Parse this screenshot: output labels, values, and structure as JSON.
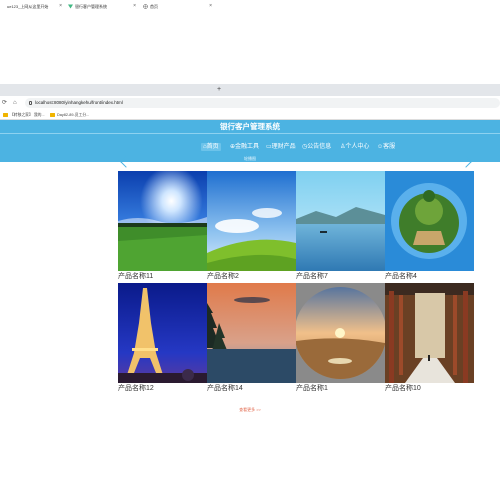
{
  "browser": {
    "tabs": [
      {
        "title": "ue123_上网从这里开始"
      },
      {
        "title": "银行客户管理系统"
      },
      {
        "title": "首页"
      }
    ],
    "new_tab": "+",
    "url": "localhost:8080/yinhangkehu/front/index.html",
    "bookmarks": [
      {
        "label": "【转移之家】 我的..."
      },
      {
        "label": "Day82-89-员工分..."
      }
    ]
  },
  "site": {
    "title": "银行客户管理系统",
    "menu": [
      {
        "label": "首页",
        "icon": "home-icon"
      },
      {
        "label": "金融工具",
        "icon": "tool-icon"
      },
      {
        "label": "理财产品",
        "icon": "product-icon"
      },
      {
        "label": "公告信息",
        "icon": "notice-icon"
      },
      {
        "label": "个人中心",
        "icon": "user-icon"
      },
      {
        "label": "客服",
        "icon": "service-icon"
      }
    ],
    "carousel_caption": "轮播图",
    "more": "查看更多 >>"
  },
  "products": [
    {
      "name": "产品名称11",
      "scene": "sunny-meadow"
    },
    {
      "name": "产品名称2",
      "scene": "green-hills"
    },
    {
      "name": "产品名称7",
      "scene": "lake-mountains"
    },
    {
      "name": "产品名称4",
      "scene": "tiny-planet"
    },
    {
      "name": "产品名称12",
      "scene": "eiffel-tower-night"
    },
    {
      "name": "产品名称14",
      "scene": "crescent-moon-sunset"
    },
    {
      "name": "产品名称1",
      "scene": "desert-sunset"
    },
    {
      "name": "产品名称10",
      "scene": "corridor"
    }
  ],
  "colors": {
    "header": "#4cb3e2",
    "accent": "#e26a4f"
  }
}
